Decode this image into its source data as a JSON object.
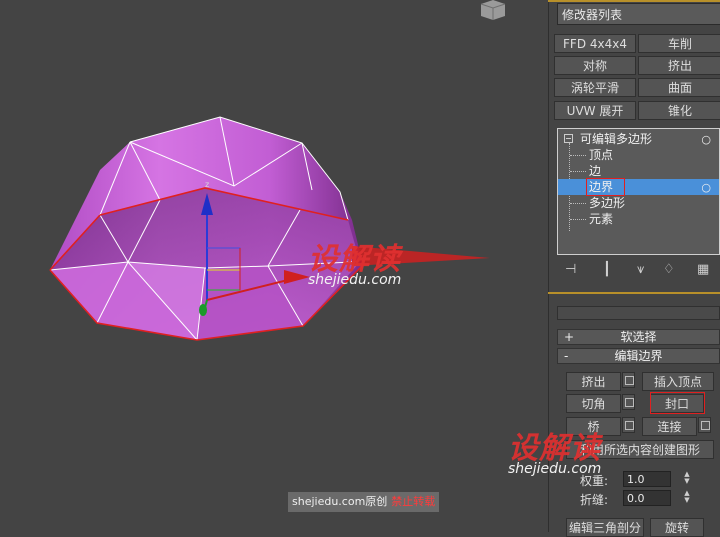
{
  "panel": {
    "modifier_list_label": "修改器列表",
    "modifier_buttons": [
      {
        "label": "FFD 4x4x4"
      },
      {
        "label": "车削"
      },
      {
        "label": "对称"
      },
      {
        "label": "挤出"
      },
      {
        "label": "涡轮平滑"
      },
      {
        "label": "曲面"
      },
      {
        "label": "UVW 展开"
      },
      {
        "label": "锥化"
      }
    ],
    "stack": {
      "root": "可编辑多边形",
      "items": [
        "顶点",
        "边",
        "边界",
        "多边形",
        "元素"
      ],
      "selected": "边界"
    },
    "toolstrip_icons": [
      "pin-stack-icon",
      "show-end-result-icon",
      "make-unique-icon",
      "remove-modifier-icon",
      "configure-sets-icon"
    ],
    "rollouts": {
      "soft_selection": {
        "sign": "+",
        "label": "软选择"
      },
      "edit_borders": {
        "sign": "-",
        "label": "编辑边界"
      }
    },
    "edit_borders": {
      "extrude": "挤出",
      "insert_vertex": "插入顶点",
      "chamfer": "切角",
      "cap": "封口",
      "bridge": "桥",
      "connect": "连接",
      "create_shape": "利用所选内容创建图形",
      "weight_label": "权重:",
      "weight_value": "1.0",
      "crease_label": "折缝:",
      "crease_value": "0.0",
      "edit_tri_label": "编辑三角剖分",
      "rotate_label": "旋转"
    }
  },
  "viewport": {
    "gizmo_axis_label": "z",
    "colors": {
      "mesh_fill": "#c060d0",
      "border_edge": "#e02020",
      "wire": "#ffffff"
    }
  },
  "watermark": {
    "brand": "设解读",
    "url": "shejiedu.com"
  },
  "credit": {
    "text": "shejiedu.com原创",
    "warning": "禁止转载"
  }
}
